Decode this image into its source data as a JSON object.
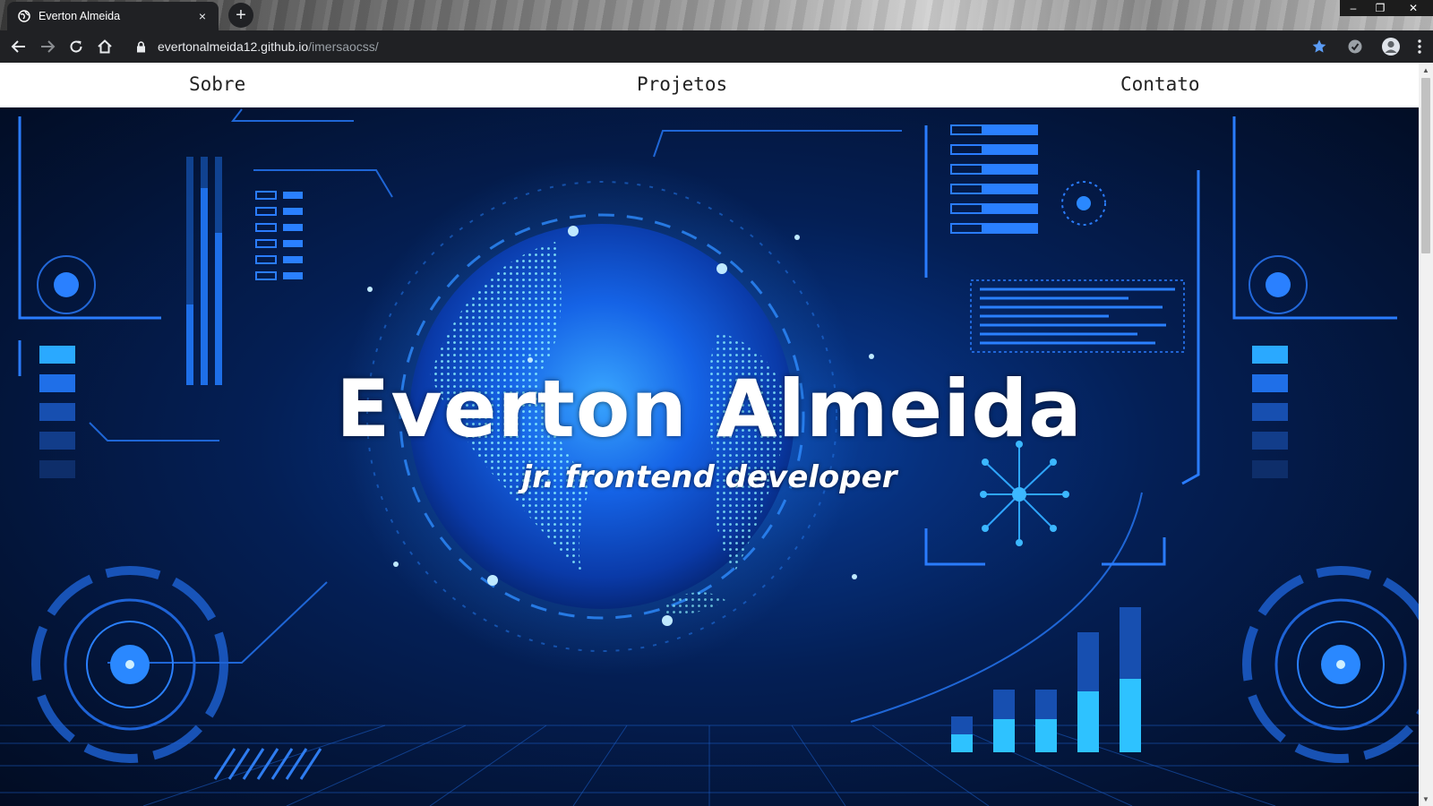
{
  "browser": {
    "tab_title": "Everton Almeida",
    "tab_close": "×",
    "new_tab": "+",
    "url_host": "evertonalmeida12.github.io",
    "url_path": "/imersaocss/",
    "window_controls": {
      "minimize": "–",
      "restore": "❐",
      "close": "✕"
    }
  },
  "nav": {
    "items": [
      "Sobre",
      "Projetos",
      "Contato"
    ]
  },
  "hero": {
    "title": "Everton Almeida",
    "subtitle": "jr. frontend developer"
  },
  "colors": {
    "accent": "#1e88ff",
    "cyan": "#36c8ff",
    "deep_blue": "#031437"
  }
}
